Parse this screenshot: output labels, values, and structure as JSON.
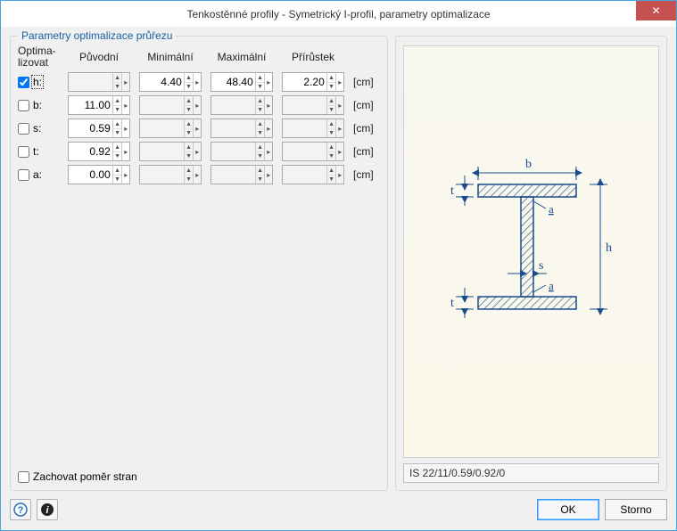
{
  "window": {
    "title": "Tenkostěnné profily - Symetrický I-profil, parametry optimalizace"
  },
  "group_legend": "Parametry optimalizace průřezu",
  "headers": {
    "optima": "Optima-\nlizovat",
    "original": "Původní",
    "min": "Minimální",
    "max": "Maximální",
    "step": "Přírůstek"
  },
  "unit": "[cm]",
  "rows": [
    {
      "name": "h",
      "label": "h:",
      "checked": true,
      "original": "",
      "min": "4.40",
      "max": "48.40",
      "step": "2.20"
    },
    {
      "name": "b",
      "label": "b:",
      "checked": false,
      "original": "11.00",
      "min": "",
      "max": "",
      "step": ""
    },
    {
      "name": "s",
      "label": "s:",
      "checked": false,
      "original": "0.59",
      "min": "",
      "max": "",
      "step": ""
    },
    {
      "name": "t",
      "label": "t:",
      "checked": false,
      "original": "0.92",
      "min": "",
      "max": "",
      "step": ""
    },
    {
      "name": "a",
      "label": "a:",
      "checked": false,
      "original": "0.00",
      "min": "",
      "max": "",
      "step": ""
    }
  ],
  "keep_ratio_label": "Zachovat poměr stran",
  "profile_name": "IS 22/11/0.59/0.92/0",
  "buttons": {
    "ok": "OK",
    "cancel": "Storno"
  },
  "icons": {
    "help": "help-icon",
    "info": "info-icon",
    "close": "close-icon"
  },
  "diagram_labels": {
    "b": "b",
    "h": "h",
    "s": "s",
    "t": "t",
    "a": "a"
  }
}
